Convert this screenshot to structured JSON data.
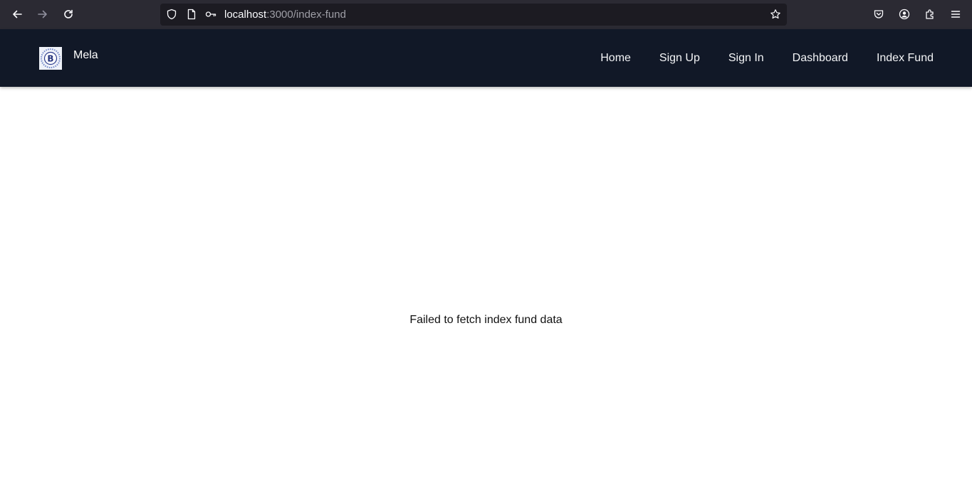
{
  "browser": {
    "url_host": "localhost",
    "url_path": ":3000/index-fund",
    "icons": [
      "back-icon",
      "forward-icon",
      "reload-icon",
      "shield-icon",
      "page-icon",
      "key-icon",
      "star-icon",
      "pocket-icon",
      "account-icon",
      "extensions-icon",
      "menu-icon"
    ]
  },
  "header": {
    "brand": "Mela",
    "logo_letter": "B",
    "nav": [
      {
        "label": "Home"
      },
      {
        "label": "Sign Up"
      },
      {
        "label": "Sign In"
      },
      {
        "label": "Dashboard"
      },
      {
        "label": "Index Fund"
      }
    ]
  },
  "main": {
    "error_message": "Failed to fetch index fund data"
  },
  "colors": {
    "toolbar_bg": "#2b2a33",
    "header_bg": "#111827",
    "page_bg": "#ffffff"
  }
}
